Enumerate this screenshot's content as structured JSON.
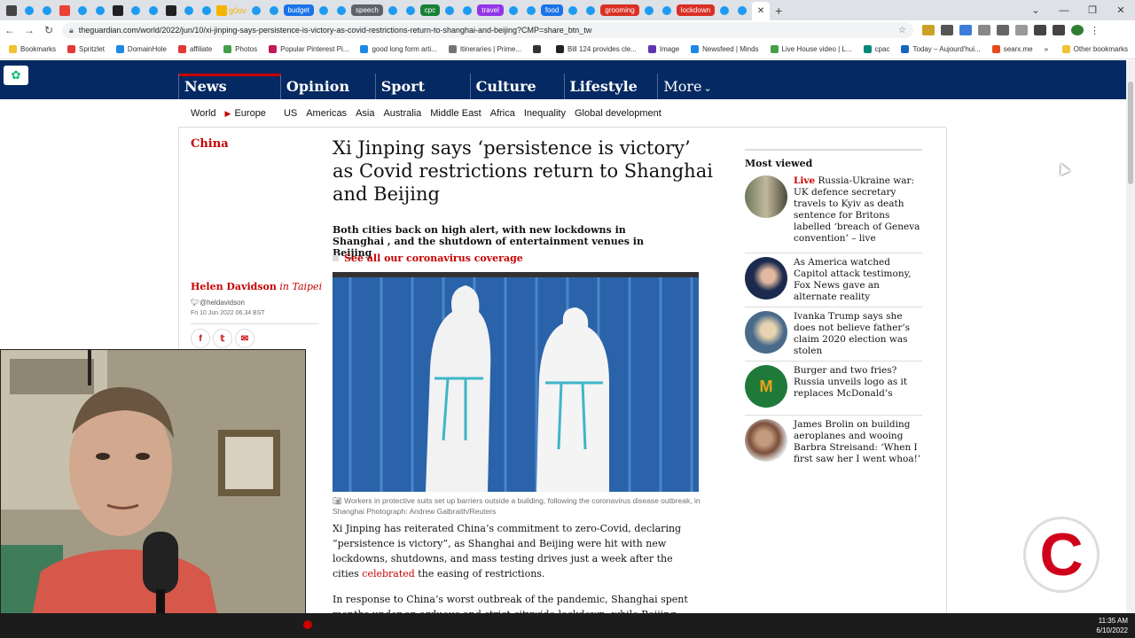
{
  "browser": {
    "tabs": [
      {
        "label": "",
        "color": "#444444"
      },
      {
        "label": "",
        "color": "#ea4335"
      },
      {
        "label": "",
        "color": "#222222"
      },
      {
        "label": "",
        "color": "#222222"
      },
      {
        "label": "g0ov",
        "color": "#f4b400"
      },
      {
        "label": "budget",
        "color": "#1a73e8",
        "pill": true
      },
      {
        "label": "speech",
        "color": "#5f6368",
        "pill": true
      },
      {
        "label": "cpc",
        "color": "#188038",
        "pill": true
      },
      {
        "label": "travel",
        "color": "#9334e6",
        "pill": true
      },
      {
        "label": "food",
        "color": "#1a73e8",
        "pill": true
      },
      {
        "label": "grooming",
        "color": "#d93025",
        "pill": true
      },
      {
        "label": "lockdown",
        "color": "#d93025",
        "pill": true
      }
    ],
    "new_tab_label": "+",
    "url": "theguardian.com/world/2022/jun/10/xi-jinping-says-persistence-is-victory-as-covid-restrictions-return-to-shanghai-and-beijing?CMP=share_btn_tw",
    "bookmarks": [
      "Bookmarks",
      "Spritzlet",
      "DomainHole",
      "affiliate",
      "Photos",
      "Popular Pinterest Pi...",
      "good long form arti...",
      "Itineraries | Prime...",
      "",
      "Bill 124 provides cle...",
      "Image",
      "Newsfeed | Minds",
      "Live House video | L...",
      "cpac",
      "Today – Aujourd'hui...",
      "searx.me"
    ],
    "other_bookmarks": "Other bookmarks"
  },
  "guardian": {
    "pillars": [
      "News",
      "Opinion",
      "Sport",
      "Culture",
      "Lifestyle"
    ],
    "more_label": "More",
    "subnav": [
      "World",
      "Europe",
      "US",
      "Americas",
      "Asia",
      "Australia",
      "Middle East",
      "Africa",
      "Inequality",
      "Global development"
    ],
    "section": "China",
    "headline": "Xi Jinping says ‘persistence is victory’ as Covid restrictions return to Shanghai and Beijing",
    "standfirst": "Both cities back on high alert, with new lockdowns in Shanghai , and the shutdown of entertainment venues in Beijing",
    "coverage_link": "See all our coronavirus coverage",
    "author": "Helen Davidson",
    "author_location": "in Taipei",
    "twitter_handle": "@heldavidson",
    "date": "Fri 10 Jun 2022 06.34 BST",
    "caption": "Workers in protective suits set up barriers outside a building, following the coronavirus disease outbreak, in Shanghai Photograph: Andrew Galbraith/Reuters",
    "body_p1_start": "Xi Jinping has reiterated China’s commitment to zero-Covid, declaring “persistence is victory”, as Shanghai and Beijing were hit with new lockdowns, shutdowns, and mass testing drives just a week after the cities ",
    "body_p1_link": "celebrated",
    "body_p1_end": " the easing of restrictions.",
    "body_p2": "In response to China’s worst outbreak of the pandemic, Shanghai spent months under an arduous and strict citywide lockdown, while Beijing",
    "most_viewed_title": "Most viewed",
    "most_viewed": [
      {
        "kicker": "Live",
        "text": "Russia-Ukraine war: UK defence secretary travels to Kyiv as death sentence for Britons labelled ‘breach of Geneva convention’ – live"
      },
      {
        "kicker": "",
        "text": "As America watched Capitol attack testimony, Fox News gave an alternate reality"
      },
      {
        "kicker": "",
        "text": "Ivanka Trump says she does not believe father’s claim 2020 election was stolen"
      },
      {
        "kicker": "",
        "text": "Burger and two fries? Russia unveils logo as it replaces McDonald’s"
      },
      {
        "kicker": "",
        "text": "James Brolin on building aeroplanes and wooing Barbra Streisand: ‘When I first saw her I went whoa!’"
      }
    ]
  },
  "overlay_logo_letter": "C",
  "clock": {
    "time": "11:35 AM",
    "date": "6/10/2022"
  }
}
